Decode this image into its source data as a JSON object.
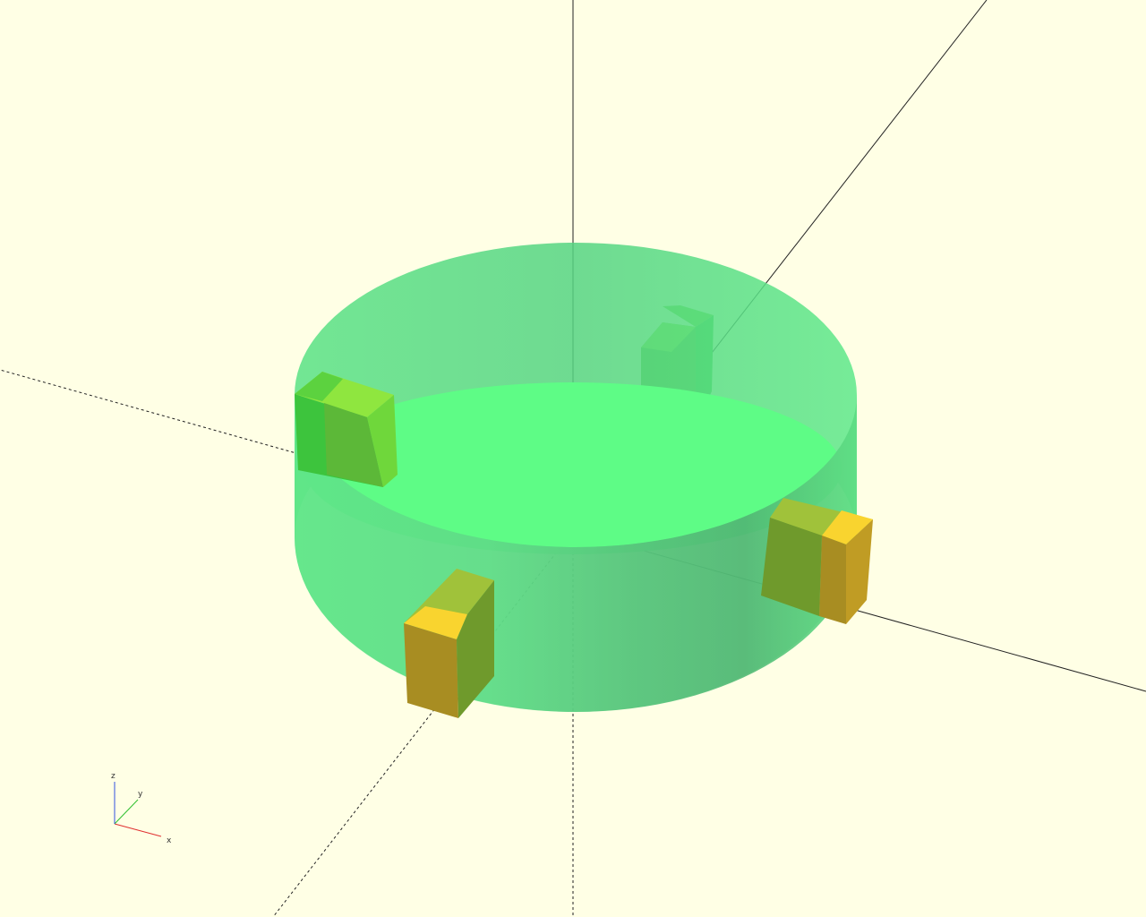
{
  "viewport": {
    "background": "#ffffe5"
  },
  "scene": {
    "cylinder_color": "#3ce678",
    "cylinder_top_color": "#5efc86",
    "green_box_colors": {
      "top": "#8fe63f",
      "front": "#5cb838",
      "side": "#3dc43d"
    },
    "yellow_box_colors": {
      "top": "#f9d42f",
      "front": "#a88d22",
      "side": "#6f9a2c"
    }
  },
  "axes_gizmo": {
    "x_label": "x",
    "y_label": "y",
    "z_label": "z",
    "x_color": "#e03030",
    "y_color": "#30c030",
    "z_color": "#3050e0"
  }
}
